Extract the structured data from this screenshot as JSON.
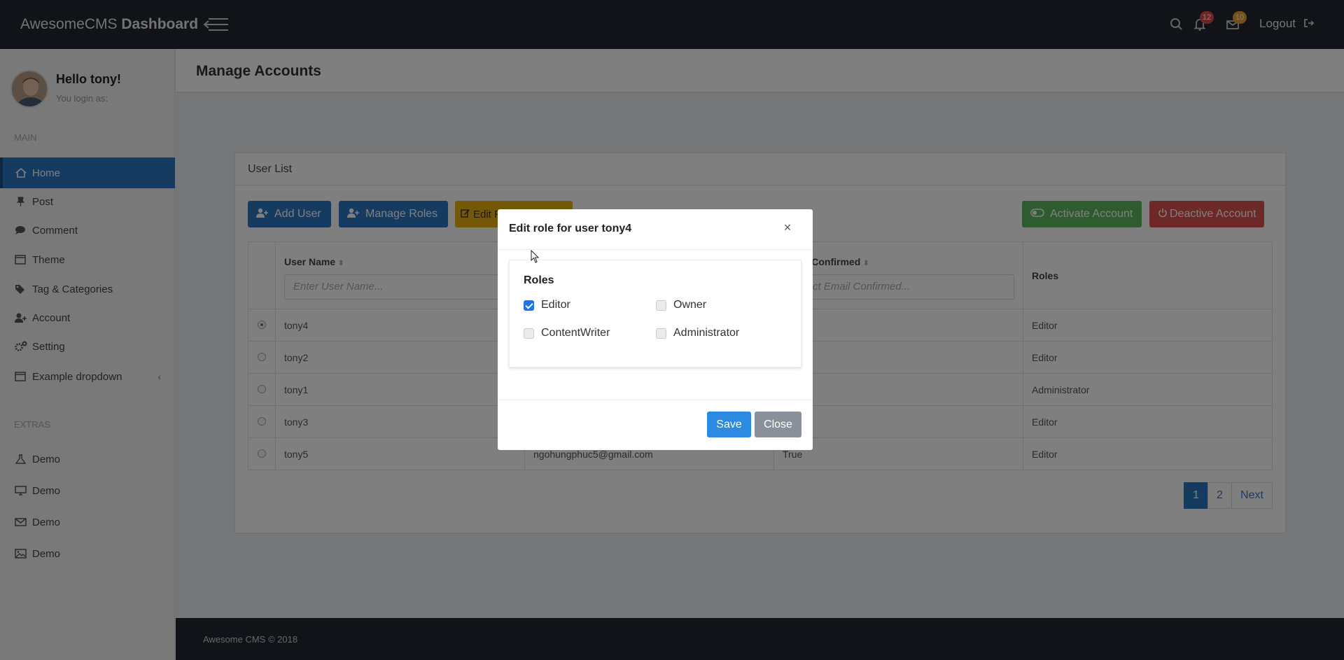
{
  "app": {
    "brand_light": "AwesomeCMS",
    "brand_bold": "Dashboard"
  },
  "topbar": {
    "notif_count": "12",
    "mail_count": "10",
    "logout_label": "Logout"
  },
  "sidebar": {
    "greeting": "Hello tony!",
    "login_as": "You login as:",
    "main_label": "MAIN",
    "extras_label": "EXTRAS",
    "items": [
      {
        "label": "Home",
        "icon": "home-icon"
      },
      {
        "label": "Post",
        "icon": "pin-icon"
      },
      {
        "label": "Comment",
        "icon": "comment-icon"
      },
      {
        "label": "Theme",
        "icon": "theme-icon"
      },
      {
        "label": "Tag & Categories",
        "icon": "tags-icon"
      },
      {
        "label": "Account",
        "icon": "user-plus-icon"
      },
      {
        "label": "Setting",
        "icon": "gears-icon"
      },
      {
        "label": "Example dropdown",
        "icon": "window-icon"
      }
    ],
    "extras": [
      {
        "label": "Demo",
        "icon": "flask-icon"
      },
      {
        "label": "Demo",
        "icon": "monitor-icon"
      },
      {
        "label": "Demo",
        "icon": "envelope-icon"
      },
      {
        "label": "Demo",
        "icon": "image-icon"
      }
    ]
  },
  "header": {
    "title": "Manage Accounts"
  },
  "card": {
    "title": "User List",
    "buttons": {
      "add_user": "Add User",
      "manage_roles": "Manage Roles",
      "edit_role": "Edit Role for User",
      "activate": "Activate Account",
      "deactivate": "Deactive Account"
    },
    "columns": {
      "username": "User Name",
      "email_confirmed": "Email Confirmed",
      "roles": "Roles"
    },
    "filters": {
      "username_placeholder": "Enter User Name...",
      "email_confirmed_placeholder": "Select Email Confirmed..."
    },
    "rows": [
      {
        "username": "tony4",
        "email": "",
        "confirmed": "",
        "roles": "Editor",
        "selected": true
      },
      {
        "username": "tony2",
        "email": "",
        "confirmed": "",
        "roles": "Editor",
        "selected": false
      },
      {
        "username": "tony1",
        "email": "",
        "confirmed": "",
        "roles": "Administrator",
        "selected": false
      },
      {
        "username": "tony3",
        "email": "",
        "confirmed": "",
        "roles": "Editor",
        "selected": false
      },
      {
        "username": "tony5",
        "email": "ngohungphuc5@gmail.com",
        "confirmed": "True",
        "roles": "Editor",
        "selected": false
      }
    ],
    "pagination": {
      "page1": "1",
      "page2": "2",
      "next": "Next"
    }
  },
  "footer": {
    "text": "Awesome CMS © 2018"
  },
  "modal": {
    "title": "Edit role for user tony4",
    "close_glyph": "×",
    "roles_label": "Roles",
    "roles": [
      {
        "label": "Editor",
        "checked": true
      },
      {
        "label": "Owner",
        "checked": false
      },
      {
        "label": "ContentWriter",
        "checked": false
      },
      {
        "label": "Administrator",
        "checked": false
      }
    ],
    "save_label": "Save",
    "close_label": "Close"
  },
  "colors": {
    "primary": "#2c77c0",
    "success": "#5cb85c",
    "danger": "#d9534f",
    "warning": "#e8b10c",
    "topbar": "#232731"
  }
}
